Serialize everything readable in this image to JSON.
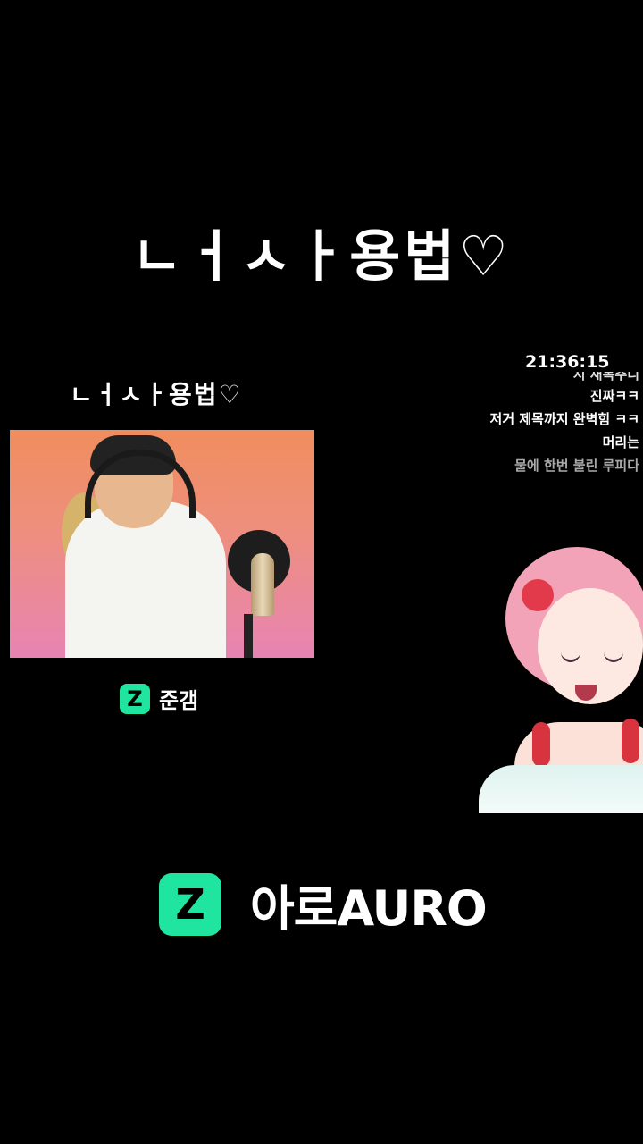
{
  "title_big": "ㄴㅓㅅㅏ용법♡",
  "title_small": "ㄴㅓㅅㅏ용법♡",
  "channel": {
    "logo_glyph": "Z",
    "name": "준갬",
    "accent": "#20e5a0"
  },
  "stream_overlay": {
    "clock": "21:36:15",
    "chat": [
      "진짜ㅋㅋ",
      "저거 제목까지 완벽힘 ㅋㅋ",
      "머리는",
      "물에 한번 불린 루피다"
    ]
  },
  "brand": {
    "logo_glyph": "Z",
    "name": "아로AURO",
    "accent": "#20e5a0"
  }
}
